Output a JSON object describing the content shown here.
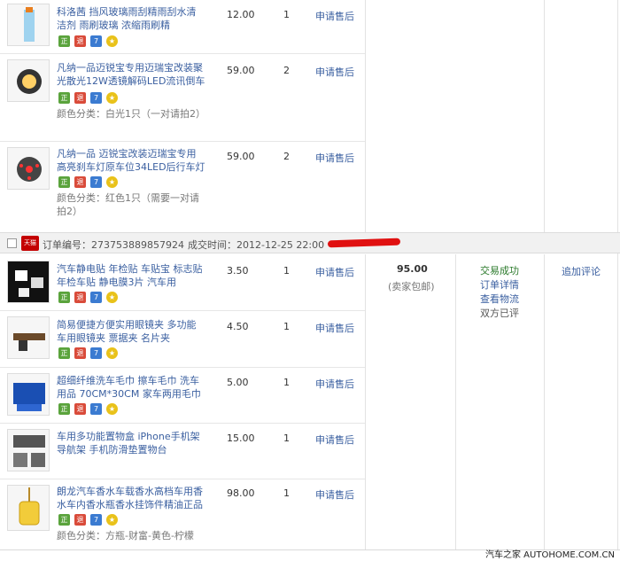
{
  "orders": {
    "prev_items": [
      {
        "title": "科洛茜 挡风玻璃雨刮精雨刮水清洁剂 雨刷玻璃 浓缩雨刷精",
        "sku": "",
        "price": "12.00",
        "qty": "1",
        "after_sale": "申请售后"
      },
      {
        "title": "凡纳一品迈锐宝专用迈瑞宝改装聚光散光12W透镜解码LED流讯倒车",
        "sku": "颜色分类：白光1只（一对请拍2）",
        "price": "59.00",
        "qty": "2",
        "after_sale": "申请售后"
      },
      {
        "title": "凡纳一品 迈锐宝改装迈瑞宝专用高亮刹车灯原车位34LED后行车灯",
        "sku": "颜色分类：红色1只（需要一对请拍2）",
        "price": "59.00",
        "qty": "2",
        "after_sale": "申请售后"
      }
    ],
    "header": {
      "shop_badge": "天猫",
      "order_no": "订单编号：273753889857924",
      "deal_time": "成交时间：2012-12-25 22:00"
    },
    "items": [
      {
        "title": "汽车静电贴 年检贴 车贴宝 标志贴 年检车贴 静电膜3片 汽车用",
        "sku": "",
        "price": "3.50",
        "qty": "1",
        "after_sale": "申请售后"
      },
      {
        "title": "简易便捷方便实用眼镜夹 多功能 车用眼镜夹 票据夹 名片夹",
        "sku": "",
        "price": "4.50",
        "qty": "1",
        "after_sale": "申请售后"
      },
      {
        "title": "超细纤维洗车毛巾 擦车毛巾 洗车用品 70CM*30CM 家车两用毛巾",
        "sku": "",
        "price": "5.00",
        "qty": "1",
        "after_sale": "申请售后"
      },
      {
        "title": "车用多功能置物盒 iPhone手机架 导航架 手机防滑垫置物台",
        "sku": "",
        "price": "15.00",
        "qty": "1",
        "after_sale": "申请售后"
      },
      {
        "title": "朗龙汽车香水车载香水高档车用香水车内香水瓶香水挂饰件精油正品",
        "sku": "颜色分类：方瓶-财富-黄色-柠檬",
        "price": "98.00",
        "qty": "1",
        "after_sale": "申请售后"
      }
    ],
    "summary": {
      "total": "95.00",
      "shipping": "(卖家包邮)",
      "status": "交易成功",
      "detail_link": "订单详情",
      "logistics_link": "查看物流",
      "rated": "双方已评",
      "review_link": "追加评论"
    },
    "badge_labels": [
      "正",
      "退",
      "7",
      "★"
    ]
  },
  "watermark": "汽车之家  AUTOHOME.COM.CN",
  "colors": {
    "link": "#3a5fa0",
    "success": "#2b7a2b",
    "header_bg": "#f1f1f1",
    "tmall_red": "#c40000"
  }
}
